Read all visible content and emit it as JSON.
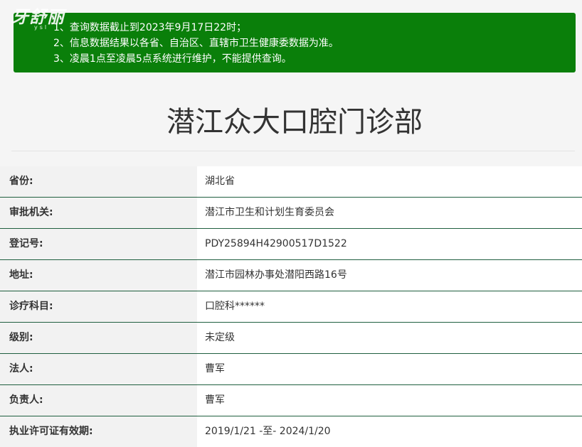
{
  "logo": {
    "text": "牙舒丽",
    "sub": "ysl"
  },
  "notice": {
    "lines": [
      "1、查询数据截止到2023年9月17日22时；",
      "2、信息数据结果以各省、自治区、直辖市卫生健康委数据为准。",
      "3、凌晨1点至凌晨5点系统进行维护，不能提供查询。"
    ],
    "background": "#0a7f0a"
  },
  "title": "潜江众大口腔门诊部",
  "rows": [
    {
      "label": "省份:",
      "value": "湖北省"
    },
    {
      "label": "审批机关:",
      "value": "潜江市卫生和计划生育委员会"
    },
    {
      "label": "登记号:",
      "value": "PDY25894H42900517D1522"
    },
    {
      "label": "地址:",
      "value": "潜江市园林办事处潜阳西路16号"
    },
    {
      "label": "诊疗科目:",
      "value": "口腔科******"
    },
    {
      "label": "级别:",
      "value": "未定级"
    },
    {
      "label": "法人:",
      "value": "曹军"
    },
    {
      "label": "负责人:",
      "value": "曹军"
    },
    {
      "label": "执业许可证有效期:",
      "value": "2019/1/21 -至- 2024/1/20"
    }
  ],
  "colors": {
    "row_divider": "#1f5f3f",
    "label_bg": "#f2f2f2",
    "value_bg": "#ffffff"
  }
}
